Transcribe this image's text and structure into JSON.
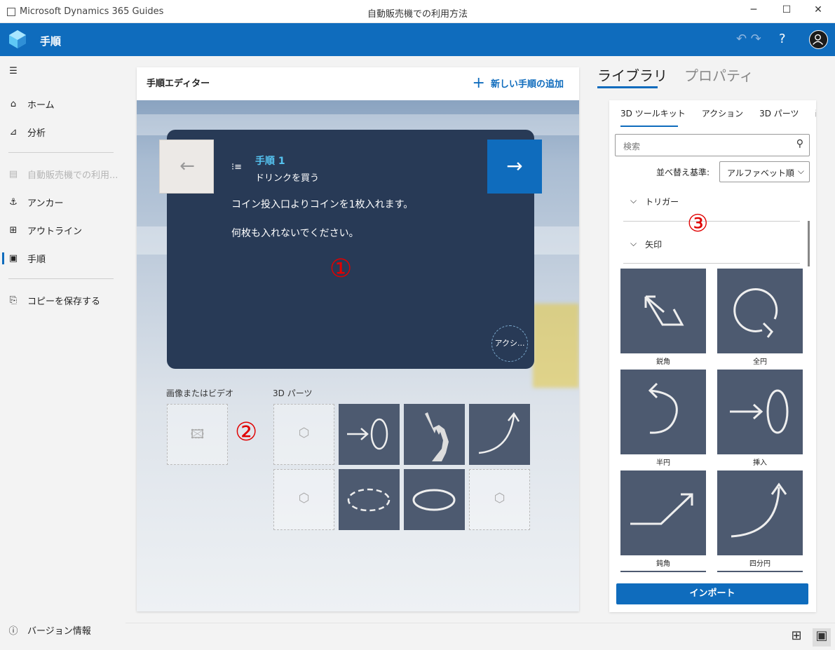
{
  "window": {
    "app_title": "Microsoft Dynamics 365 Guides",
    "document_title": "自動販売機での利用方法",
    "minimize": "─",
    "maximize": "☐",
    "close": "✕"
  },
  "header": {
    "title": "手順",
    "help": "?",
    "colors": {
      "brand": "#0f6cbd"
    }
  },
  "sidebar": {
    "menu_icon": "☰",
    "items": [
      {
        "label": "ホーム",
        "icon": "home-icon",
        "glyph": "⌂"
      },
      {
        "label": "分析",
        "icon": "chart-icon",
        "glyph": "⊿"
      },
      {
        "label": "自動販売機での利用...",
        "icon": "guide-icon",
        "glyph": "▤"
      },
      {
        "label": "アンカー",
        "icon": "anchor-icon",
        "glyph": "⚓"
      },
      {
        "label": "アウトライン",
        "icon": "outline-icon",
        "glyph": "⊞"
      },
      {
        "label": "手順",
        "icon": "step-icon",
        "glyph": "▣"
      },
      {
        "label": "コピーを保存する",
        "icon": "save-icon",
        "glyph": "⎘"
      }
    ],
    "version": {
      "label": "バージョン情報",
      "glyph": "ⓘ"
    }
  },
  "editor": {
    "title": "手順エディター",
    "add_step": "新しい手順の追加",
    "add_glyph": "+",
    "card": {
      "step_number": "手順 1",
      "step_title": "ドリンクを買う",
      "line1": "コイン投入口よりコインを1枚入れます。",
      "line2": "何枚も入れないでください。",
      "action": "アクシ...",
      "prev_glyph": "←",
      "next_glyph": "→"
    },
    "media_label": "画像またはビデオ",
    "parts_label": "3D パーツ",
    "annotation1": "①",
    "annotation2": "②"
  },
  "right_panel": {
    "tabs": [
      "ライブラリ",
      "プロパティ"
    ],
    "subtabs": [
      "3D ツールキット",
      "アクション",
      "3D パーツ",
      "画像"
    ],
    "search_placeholder": "検索",
    "sort_label": "並べ替え基準:",
    "sort_value": "アルファベット順",
    "sections": [
      "トリガー",
      "矢印"
    ],
    "annotation3": "③",
    "items": [
      "鋭角",
      "全円",
      "半円",
      "挿入",
      "鈍角",
      "四分円"
    ],
    "import_button": "インポート"
  }
}
